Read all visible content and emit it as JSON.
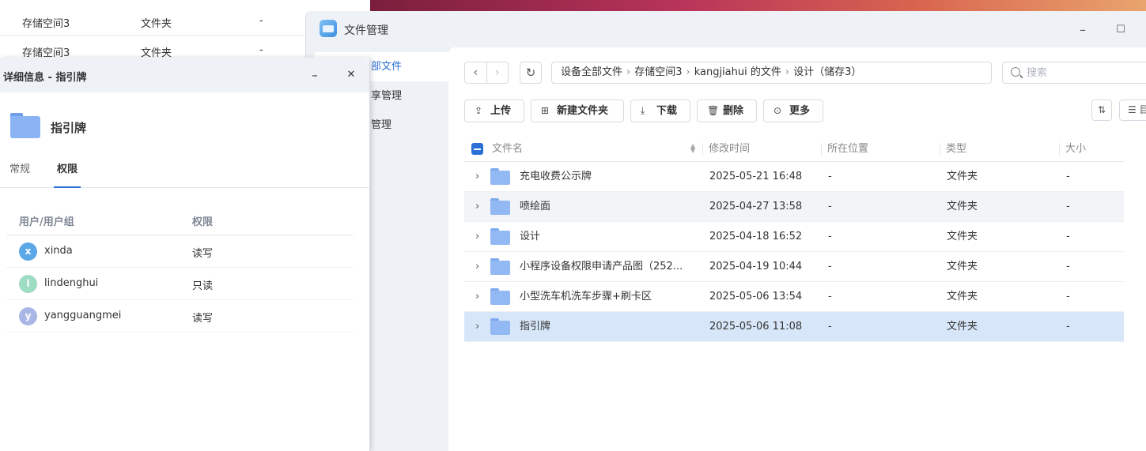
{
  "background_list": {
    "rows": [
      {
        "name": "存储空间3",
        "type": "文件夹",
        "size": "-"
      },
      {
        "name": "存储空间3",
        "type": "文件夹",
        "size": "-"
      }
    ]
  },
  "file_manager": {
    "title": "文件管理",
    "window_buttons": {
      "minimize": "–",
      "maximize": "☐"
    },
    "sidebar": {
      "items": [
        {
          "label": "部文件",
          "active": true
        },
        {
          "label": "享管理",
          "active": false
        },
        {
          "label": "管理",
          "active": false
        }
      ]
    },
    "breadcrumb": [
      "设备全部文件",
      "存储空间3",
      "kangjiahui 的文件",
      "设计（储存3）"
    ],
    "breadcrumb_sep": "›",
    "search": {
      "placeholder": "搜索"
    },
    "toolbar": {
      "upload": "上传",
      "new_folder": "新建文件夹",
      "download": "下载",
      "delete": "删除",
      "more": "更多"
    },
    "view_button_text": "☰ 目",
    "columns": {
      "name": "文件名",
      "modified": "修改时间",
      "location": "所在位置",
      "type": "类型",
      "size": "大小"
    },
    "files": [
      {
        "name": "充电收费公示牌",
        "modified": "2025-05-21 16:48",
        "location": "-",
        "type": "文件夹",
        "size": "-",
        "state": "normal"
      },
      {
        "name": "喷绘面",
        "modified": "2025-04-27 13:58",
        "location": "-",
        "type": "文件夹",
        "size": "-",
        "state": "hover"
      },
      {
        "name": "设计",
        "modified": "2025-04-18 16:52",
        "location": "-",
        "type": "文件夹",
        "size": "-",
        "state": "normal"
      },
      {
        "name": "小程序设备权限申请产品图（252...",
        "modified": "2025-04-19 10:44",
        "location": "-",
        "type": "文件夹",
        "size": "-",
        "state": "normal"
      },
      {
        "name": "小型洗车机洗车步骤+刷卡区",
        "modified": "2025-05-06 13:54",
        "location": "-",
        "type": "文件夹",
        "size": "-",
        "state": "normal"
      },
      {
        "name": "指引牌",
        "modified": "2025-05-06 11:08",
        "location": "-",
        "type": "文件夹",
        "size": "-",
        "state": "selected"
      }
    ]
  },
  "detail_dialog": {
    "title": "详细信息 - 指引牌",
    "minimize": "–",
    "close": "✕",
    "item_name": "指引牌",
    "tabs": [
      {
        "label": "常规",
        "active": false
      },
      {
        "label": "权限",
        "active": true
      }
    ],
    "permissions": {
      "col_user": "用户/用户组",
      "col_permission": "权限",
      "rows": [
        {
          "initial": "x",
          "user": "xinda",
          "permission": "读写",
          "color": "#5aa8e8"
        },
        {
          "initial": "l",
          "user": "lindenghui",
          "permission": "只读",
          "color": "#9fdcc4"
        },
        {
          "initial": "y",
          "user": "yangguangmei",
          "permission": "读写",
          "color": "#a9b7e6"
        }
      ]
    }
  },
  "colors": {
    "accent": "#2a6fd6",
    "selected_row": "#d7e6f8",
    "hover_row": "#f2f4f7",
    "folder": "#93b9f5"
  }
}
